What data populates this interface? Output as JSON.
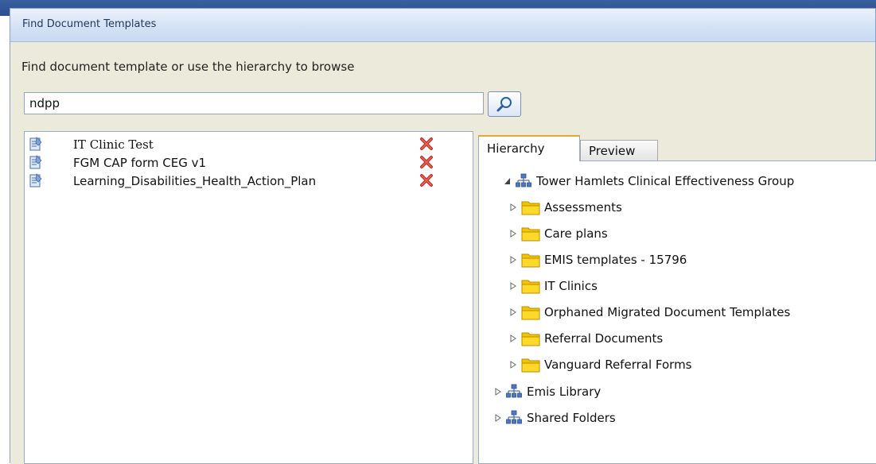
{
  "dialog": {
    "title": "Find Document Templates",
    "instruction": "Find document template or use the hierarchy to browse"
  },
  "search": {
    "value": "ndpp"
  },
  "results": [
    {
      "label": "IT Clinic Test"
    },
    {
      "label": "FGM CAP form CEG v1"
    },
    {
      "label": "Learning_Disabilities_Health_Action_Plan"
    }
  ],
  "tabs": [
    {
      "label": "Hierarchy",
      "active": true
    },
    {
      "label": "Preview",
      "active": false
    }
  ],
  "tree": {
    "root": {
      "label": "Tower Hamlets Clinical Effectiveness Group",
      "icon": "hierarchy-icon",
      "expanded": true
    },
    "folders": [
      {
        "label": "Assessments"
      },
      {
        "label": "Care plans"
      },
      {
        "label": "EMIS templates - 15796"
      },
      {
        "label": "IT Clinics"
      },
      {
        "label": "Orphaned Migrated Document Templates"
      },
      {
        "label": "Referral Documents"
      },
      {
        "label": "Vanguard Referral Forms"
      }
    ],
    "other_roots": [
      {
        "label": "Emis Library",
        "icon": "hierarchy-icon"
      },
      {
        "label": "Shared Folders",
        "icon": "hierarchy-icon"
      }
    ]
  },
  "colors": {
    "folder": "#f5c400",
    "delete": "#c0302a",
    "active_tab_accent": "#e8a63a"
  }
}
